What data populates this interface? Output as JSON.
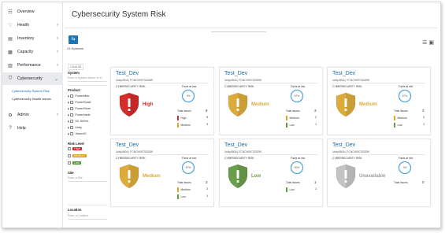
{
  "sidebar": {
    "items": [
      {
        "label": "Overview",
        "icon": "grid-icon",
        "chevron": false
      },
      {
        "label": "Health",
        "icon": "heart-icon",
        "chevron": true
      },
      {
        "label": "Inventory",
        "icon": "inventory-icon",
        "chevron": true
      },
      {
        "label": "Capacity",
        "icon": "capacity-icon",
        "chevron": true
      },
      {
        "label": "Performance",
        "icon": "chart-icon",
        "chevron": true
      },
      {
        "label": "Cybersecurity",
        "icon": "shield-icon",
        "chevron": true
      },
      {
        "label": "Admin",
        "icon": "gear-icon",
        "chevron": true
      },
      {
        "label": "Help",
        "icon": "help-icon",
        "chevron": false
      }
    ],
    "sub_items": [
      "Cybersecurity System Risk",
      "Cybersecurity Health Issues"
    ]
  },
  "header": {
    "title": "Cybersecurity System Risk"
  },
  "systems": {
    "count_label": "23 Systems"
  },
  "filters": {
    "clear_all": "Clear All",
    "system_title": "System",
    "system_placeholder": "Enter a System Name or ID",
    "product_title": "Product",
    "products": [
      "PowerMax",
      "PowerScale",
      "PowerStore",
      "PowerVault",
      "SC Series",
      "Unity",
      "XtremIO"
    ],
    "risk_title": "Risk Level",
    "risk_levels": [
      {
        "label": "High",
        "color": "#cc1f1f"
      },
      {
        "label": "Medium",
        "color": "#d79a1a"
      },
      {
        "label": "Low",
        "color": "#4f8f2f"
      }
    ],
    "site_title": "Site",
    "site_placeholder": "Enter a Site",
    "location_title": "Location",
    "location_placeholder": "Enter a Location"
  },
  "cards": [
    {
      "name": "Test_Dev",
      "serial": "Unity450A | FCNCH097323259",
      "risk_label": "CYBERSECURITY RISK",
      "risk": "High",
      "risk_color": "#d42b2b",
      "facts_label": "Facts at risk",
      "facts_value": "0%",
      "total_label": "Total issues",
      "total": "8",
      "issues": [
        {
          "label": "High",
          "value": "5",
          "color": "#d42b2b"
        },
        {
          "label": "Medium",
          "value": "3",
          "color": "#e3a41f"
        }
      ]
    },
    {
      "name": "Test_Dev",
      "serial": "Unity450A | FCNCH097323259",
      "risk_label": "CYBERSECURITY RISK",
      "risk": "Medium",
      "risk_color": "#dcab3a",
      "facts_label": "Facts at risk",
      "facts_value": "67%",
      "total_label": "Total issues",
      "total": "3",
      "issues": [
        {
          "label": "Medium",
          "value": "2",
          "color": "#e3a41f"
        },
        {
          "label": "Low",
          "value": "1",
          "color": "#5c9e3a"
        }
      ]
    },
    {
      "name": "Test_Dev",
      "serial": "Unity450A | FCNCH097323259",
      "risk_label": "CYBERSECURITY RISK",
      "risk": "Medium",
      "risk_color": "#dcab3a",
      "facts_label": "Facts at risk",
      "facts_value": "67%",
      "total_label": "Total issues",
      "total": "3",
      "issues": [
        {
          "label": "Medium",
          "value": "2",
          "color": "#e3a41f"
        },
        {
          "label": "Low",
          "value": "1",
          "color": "#5c9e3a"
        }
      ]
    },
    {
      "name": "Test_Dev",
      "serial": "Unity450A | FCNCH097323259",
      "risk_label": "CYBERSECURITY RISK",
      "risk": "Medium",
      "risk_color": "#dcab3a",
      "facts_label": "Facts at risk",
      "facts_value": "67%",
      "total_label": "Total issues",
      "total": "3",
      "issues": [
        {
          "label": "Medium",
          "value": "2",
          "color": "#e3a41f"
        },
        {
          "label": "Low",
          "value": "1",
          "color": "#5c9e3a"
        }
      ]
    },
    {
      "name": "Test_Dev",
      "serial": "Unity450A | FCNCH097323259",
      "risk_label": "CYBERSECURITY RISK",
      "risk": "Low",
      "risk_color": "#6a9e4a",
      "facts_label": "Facts at risk",
      "facts_value": "90%",
      "total_label": "Total issues",
      "total": "1",
      "issues": [
        {
          "label": "Low",
          "value": "1",
          "color": "#5c9e3a"
        }
      ]
    },
    {
      "name": "Test_Dev",
      "serial": "Unity450A | FCNCH097323259",
      "risk_label": "CYBERSECURITY RISK",
      "risk": "Unavailable",
      "risk_color": "#c4c4c4",
      "facts_label": "Facts at risk",
      "facts_value": "0%",
      "total_label": "Total issues",
      "total": "0",
      "issues": []
    }
  ]
}
